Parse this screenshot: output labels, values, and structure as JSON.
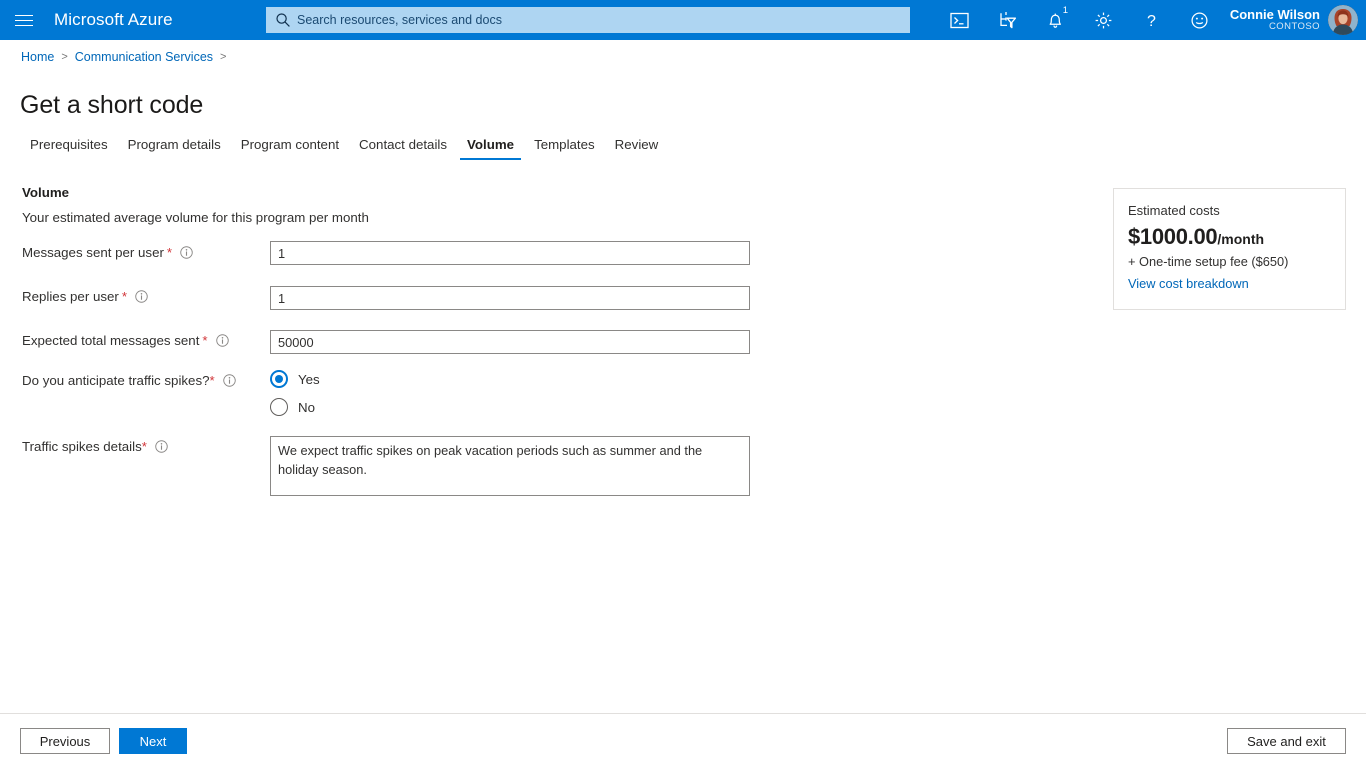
{
  "topbar": {
    "brand": "Microsoft Azure",
    "menu_icon": "hamburger-icon",
    "search": {
      "placeholder": "Search resources, services and docs",
      "value": "",
      "icon": "search-icon"
    },
    "icons": [
      {
        "name": "cloud-shell-icon",
        "label": "Cloud Shell"
      },
      {
        "name": "directory-filter-icon",
        "label": "Directories + subscriptions"
      },
      {
        "name": "notifications-bell-icon",
        "label": "Notifications",
        "badge": "1"
      },
      {
        "name": "settings-gear-icon",
        "label": "Settings"
      },
      {
        "name": "help-question-icon",
        "label": "Help"
      },
      {
        "name": "feedback-smiley-icon",
        "label": "Feedback"
      }
    ],
    "account": {
      "name": "Connie Wilson",
      "org": "CONTOSO",
      "avatar": "user-avatar"
    }
  },
  "breadcrumb": {
    "items": [
      "Home",
      "Communication Services"
    ],
    "separator": ">"
  },
  "page": {
    "title": "Get a short code"
  },
  "tabs": [
    {
      "label": "Prerequisites",
      "active": false
    },
    {
      "label": "Program details",
      "active": false
    },
    {
      "label": "Program content",
      "active": false
    },
    {
      "label": "Contact details",
      "active": false
    },
    {
      "label": "Volume",
      "active": true
    },
    {
      "label": "Templates",
      "active": false
    },
    {
      "label": "Review",
      "active": false
    }
  ],
  "form": {
    "section_title": "Volume",
    "section_description": "Your estimated average volume for this program per month",
    "fields": {
      "messages_sent": {
        "label": "Messages sent per user",
        "required_marker": "*",
        "value": "1",
        "info_icon": "info-icon"
      },
      "replies": {
        "label": "Replies per user",
        "required_marker": "*",
        "value": "1",
        "info_icon": "info-icon"
      },
      "expected_total": {
        "label": "Expected total messages sent",
        "required_marker": "*",
        "value": "50000",
        "info_icon": "info-icon"
      },
      "traffic_spikes": {
        "label": "Do you anticipate traffic spikes?",
        "required_marker": "*",
        "info_icon": "info-icon",
        "options": [
          {
            "label": "Yes",
            "selected": true
          },
          {
            "label": "No",
            "selected": false
          }
        ]
      },
      "spikes_details": {
        "label": "Traffic spikes details",
        "required_marker": "*",
        "info_icon": "info-icon",
        "value": "We expect traffic spikes on peak vacation periods such as summer and the holiday season."
      }
    }
  },
  "cost_card": {
    "title": "Estimated costs",
    "amount": "$1000.00",
    "period": "/month",
    "setup_fee": "+ One-time setup fee ($650)",
    "link": "View cost breakdown"
  },
  "footer": {
    "previous": "Previous",
    "next": "Next",
    "save_and_exit": "Save and exit"
  },
  "colors": {
    "azure_blue": "#0078d4",
    "link_blue": "#0067b8",
    "required_red": "#d13438",
    "search_bg": "#aed5f2"
  }
}
